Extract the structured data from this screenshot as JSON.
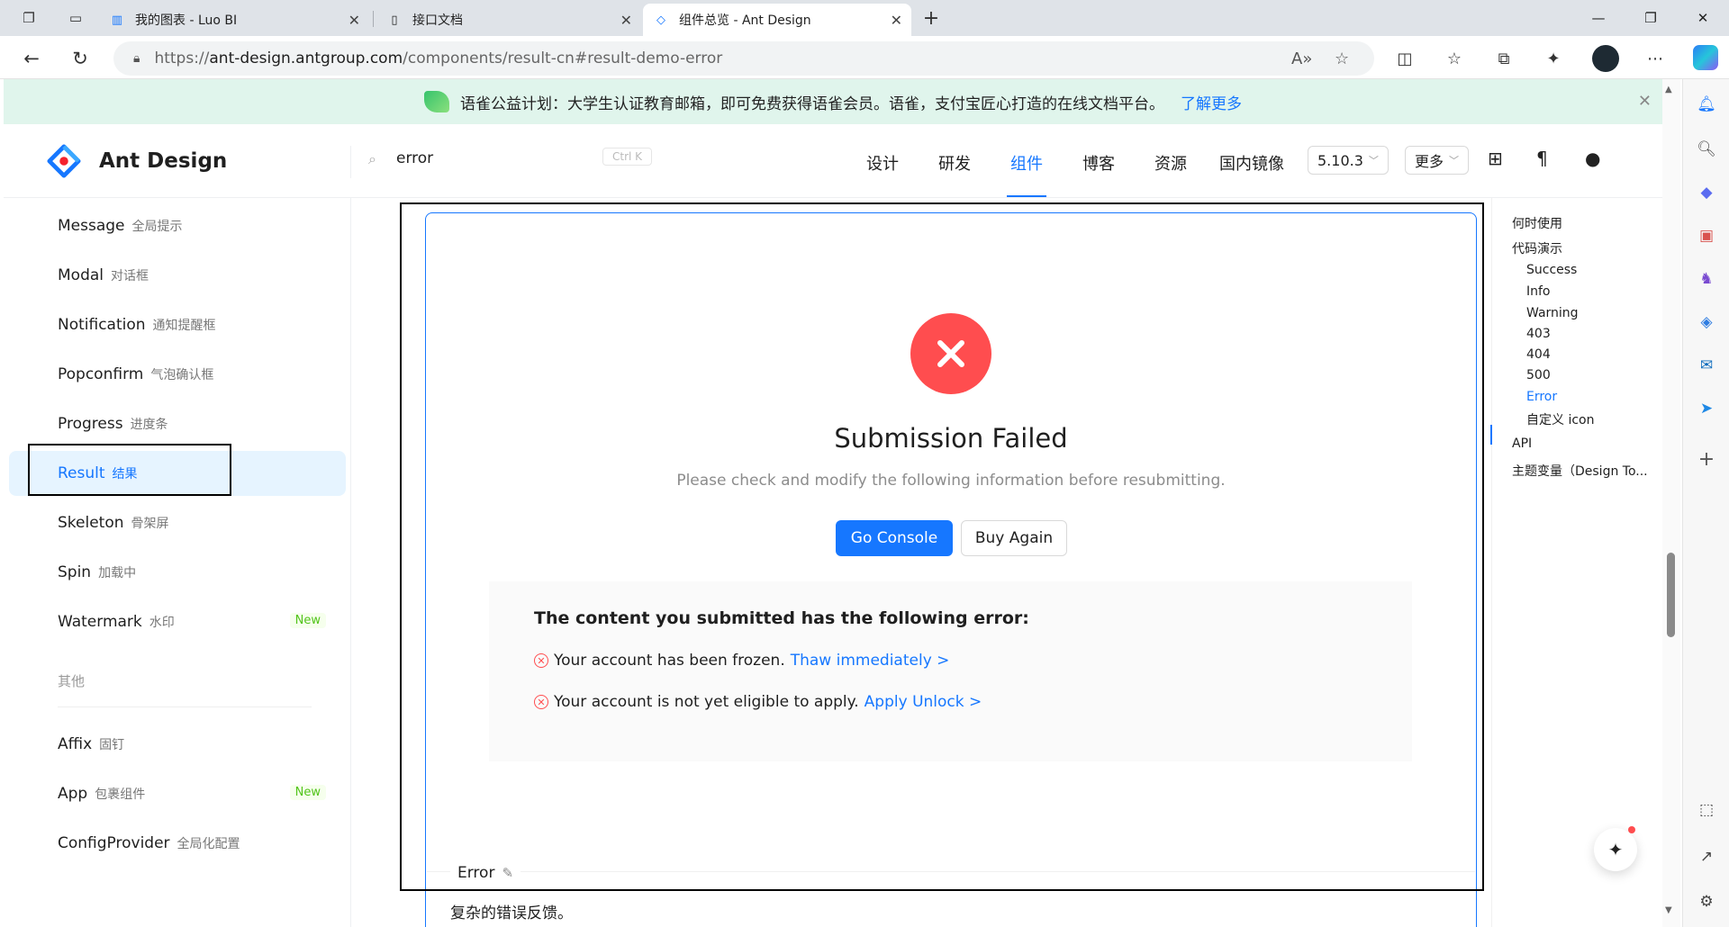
{
  "browser": {
    "tabs": [
      {
        "title": "我的图表 - Luo BI"
      },
      {
        "title": "接口文档"
      },
      {
        "title": "组件总览 - Ant Design"
      }
    ],
    "new_tab": "+",
    "url_prefix": "https://",
    "url_host": "ant-design.antgroup.com",
    "url_path": "/components/result-cn#result-demo-error"
  },
  "banner": {
    "text": "语雀公益计划：大学生认证教育邮箱，即可免费获得语雀会员。语雀，支付宝匠心打造的在线文档平台。",
    "link": "了解更多"
  },
  "header": {
    "logo": "Ant Design",
    "search_value": "error",
    "search_kbd": "Ctrl K",
    "menu": [
      "设计",
      "研发",
      "组件",
      "博客",
      "资源",
      "国内镜像"
    ],
    "active_menu": "组件",
    "version": "5.10.3",
    "more": "更多"
  },
  "leftnav": {
    "items": [
      {
        "en": "Message",
        "cn": "全局提示"
      },
      {
        "en": "Modal",
        "cn": "对话框"
      },
      {
        "en": "Notification",
        "cn": "通知提醒框"
      },
      {
        "en": "Popconfirm",
        "cn": "气泡确认框"
      },
      {
        "en": "Progress",
        "cn": "进度条"
      },
      {
        "en": "Result",
        "cn": "结果"
      },
      {
        "en": "Skeleton",
        "cn": "骨架屏"
      },
      {
        "en": "Spin",
        "cn": "加载中"
      },
      {
        "en": "Watermark",
        "cn": "水印",
        "tag": "New"
      }
    ],
    "group_other": "其他",
    "other_items": [
      {
        "en": "Affix",
        "cn": "固钉"
      },
      {
        "en": "App",
        "cn": "包裹组件",
        "tag": "New"
      },
      {
        "en": "ConfigProvider",
        "cn": "全局化配置"
      }
    ]
  },
  "result": {
    "title": "Submission Failed",
    "subtitle": "Please check and modify the following information before resubmitting.",
    "primary_button": "Go Console",
    "secondary_button": "Buy Again",
    "panel_title": "The content you submitted has the following error:",
    "errors": [
      {
        "text": "Your account has been frozen.",
        "link": "Thaw immediately >"
      },
      {
        "text": "Your account is not yet eligible to apply.",
        "link": "Apply Unlock >"
      }
    ],
    "meta_title": "Error",
    "meta_desc": "复杂的错误反馈。"
  },
  "toc": {
    "items": [
      "何时使用",
      "代码演示",
      "Success",
      "Info",
      "Warning",
      "403",
      "404",
      "500",
      "Error",
      "自定义 icon",
      "API",
      "主题变量（Design To..."
    ],
    "active": "Error"
  },
  "colors": {
    "primary": "#1677ff",
    "error": "#ff4d4f",
    "success_tag": "#52c41a",
    "banner_bg": "#e0f5ec"
  }
}
